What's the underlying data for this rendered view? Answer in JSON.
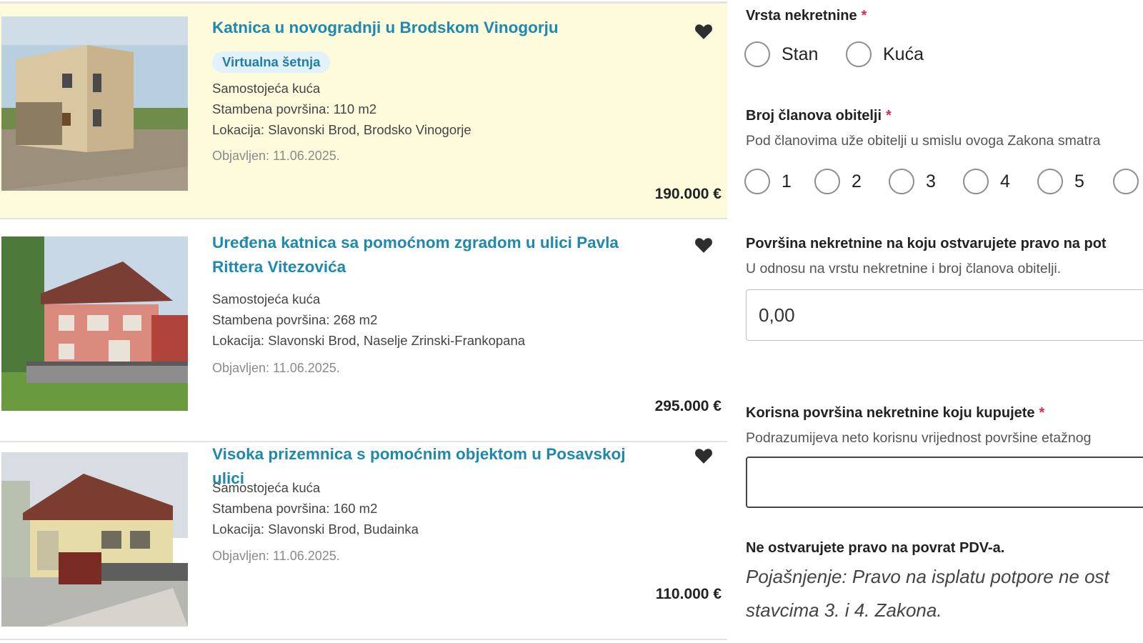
{
  "listings": [
    {
      "title": "Katnica u novogradnji u Brodskom Vinogorju",
      "badge": "Virtualna šetnja",
      "type": "Samostojeća kuća",
      "area": "Stambena površina: 110 m2",
      "location": "Lokacija: Slavonski Brod, Brodsko Vinogorje",
      "published": "Objavljen: 11.06.2025.",
      "price": "190.000 €",
      "photo_icon": "new-house-photo",
      "highlighted": true
    },
    {
      "title": "Uređena katnica sa pomoćnom zgradom u ulici Pavla Rittera Vitezovića",
      "type": "Samostojeća kuća",
      "area": "Stambena površina: 268 m2",
      "location": "Lokacija: Slavonski Brod, Naselje Zrinski-Frankopana",
      "published": "Objavljen: 11.06.2025.",
      "price": "295.000 €",
      "photo_icon": "pink-house-photo",
      "highlighted": false
    },
    {
      "title": "Visoka prizemnica s pomoćnim objektom u Posavskoj ulici",
      "type": "Samostojeća kuća",
      "area": "Stambena površina: 160 m2",
      "location": "Lokacija: Slavonski Brod, Budainka",
      "published": "Objavljen: 11.06.2025.",
      "price": "110.000 €",
      "photo_icon": "yellow-house-photo",
      "highlighted": false
    }
  ],
  "form": {
    "property_type": {
      "label": "Vrsta nekretnine",
      "required_mark": "*",
      "options": [
        "Stan",
        "Kuća"
      ]
    },
    "family_members": {
      "label": "Broj članova obitelji",
      "required_mark": "*",
      "help": "Pod članovima uže obitelji u smislu ovoga Zakona smatra",
      "options": [
        "1",
        "2",
        "3",
        "4",
        "5"
      ]
    },
    "entitled_area": {
      "label": "Površina nekretnine na koju ostvarujete pravo na pot",
      "help": "U odnosu na vrstu nekretnine i broj članova obitelji.",
      "value": "0,00"
    },
    "usable_area": {
      "label": "Korisna površina nekretnine koju kupujete",
      "required_mark": "*",
      "help": "Podrazumijeva neto korisnu vrijednost površine etažnog",
      "value": ""
    },
    "result": {
      "heading": "Ne ostvarujete pravo na povrat PDV-a.",
      "explanation_line1": "Pojašnjenje: Pravo na isplatu potpore ne ost",
      "explanation_line2": "stavcima 3. i 4. Zakona."
    }
  },
  "colors": {
    "link": "#1f88ad",
    "highlight_bg": "#fdfbdc",
    "badge_bg": "#e3f1fb",
    "required": "#d32f4a"
  }
}
